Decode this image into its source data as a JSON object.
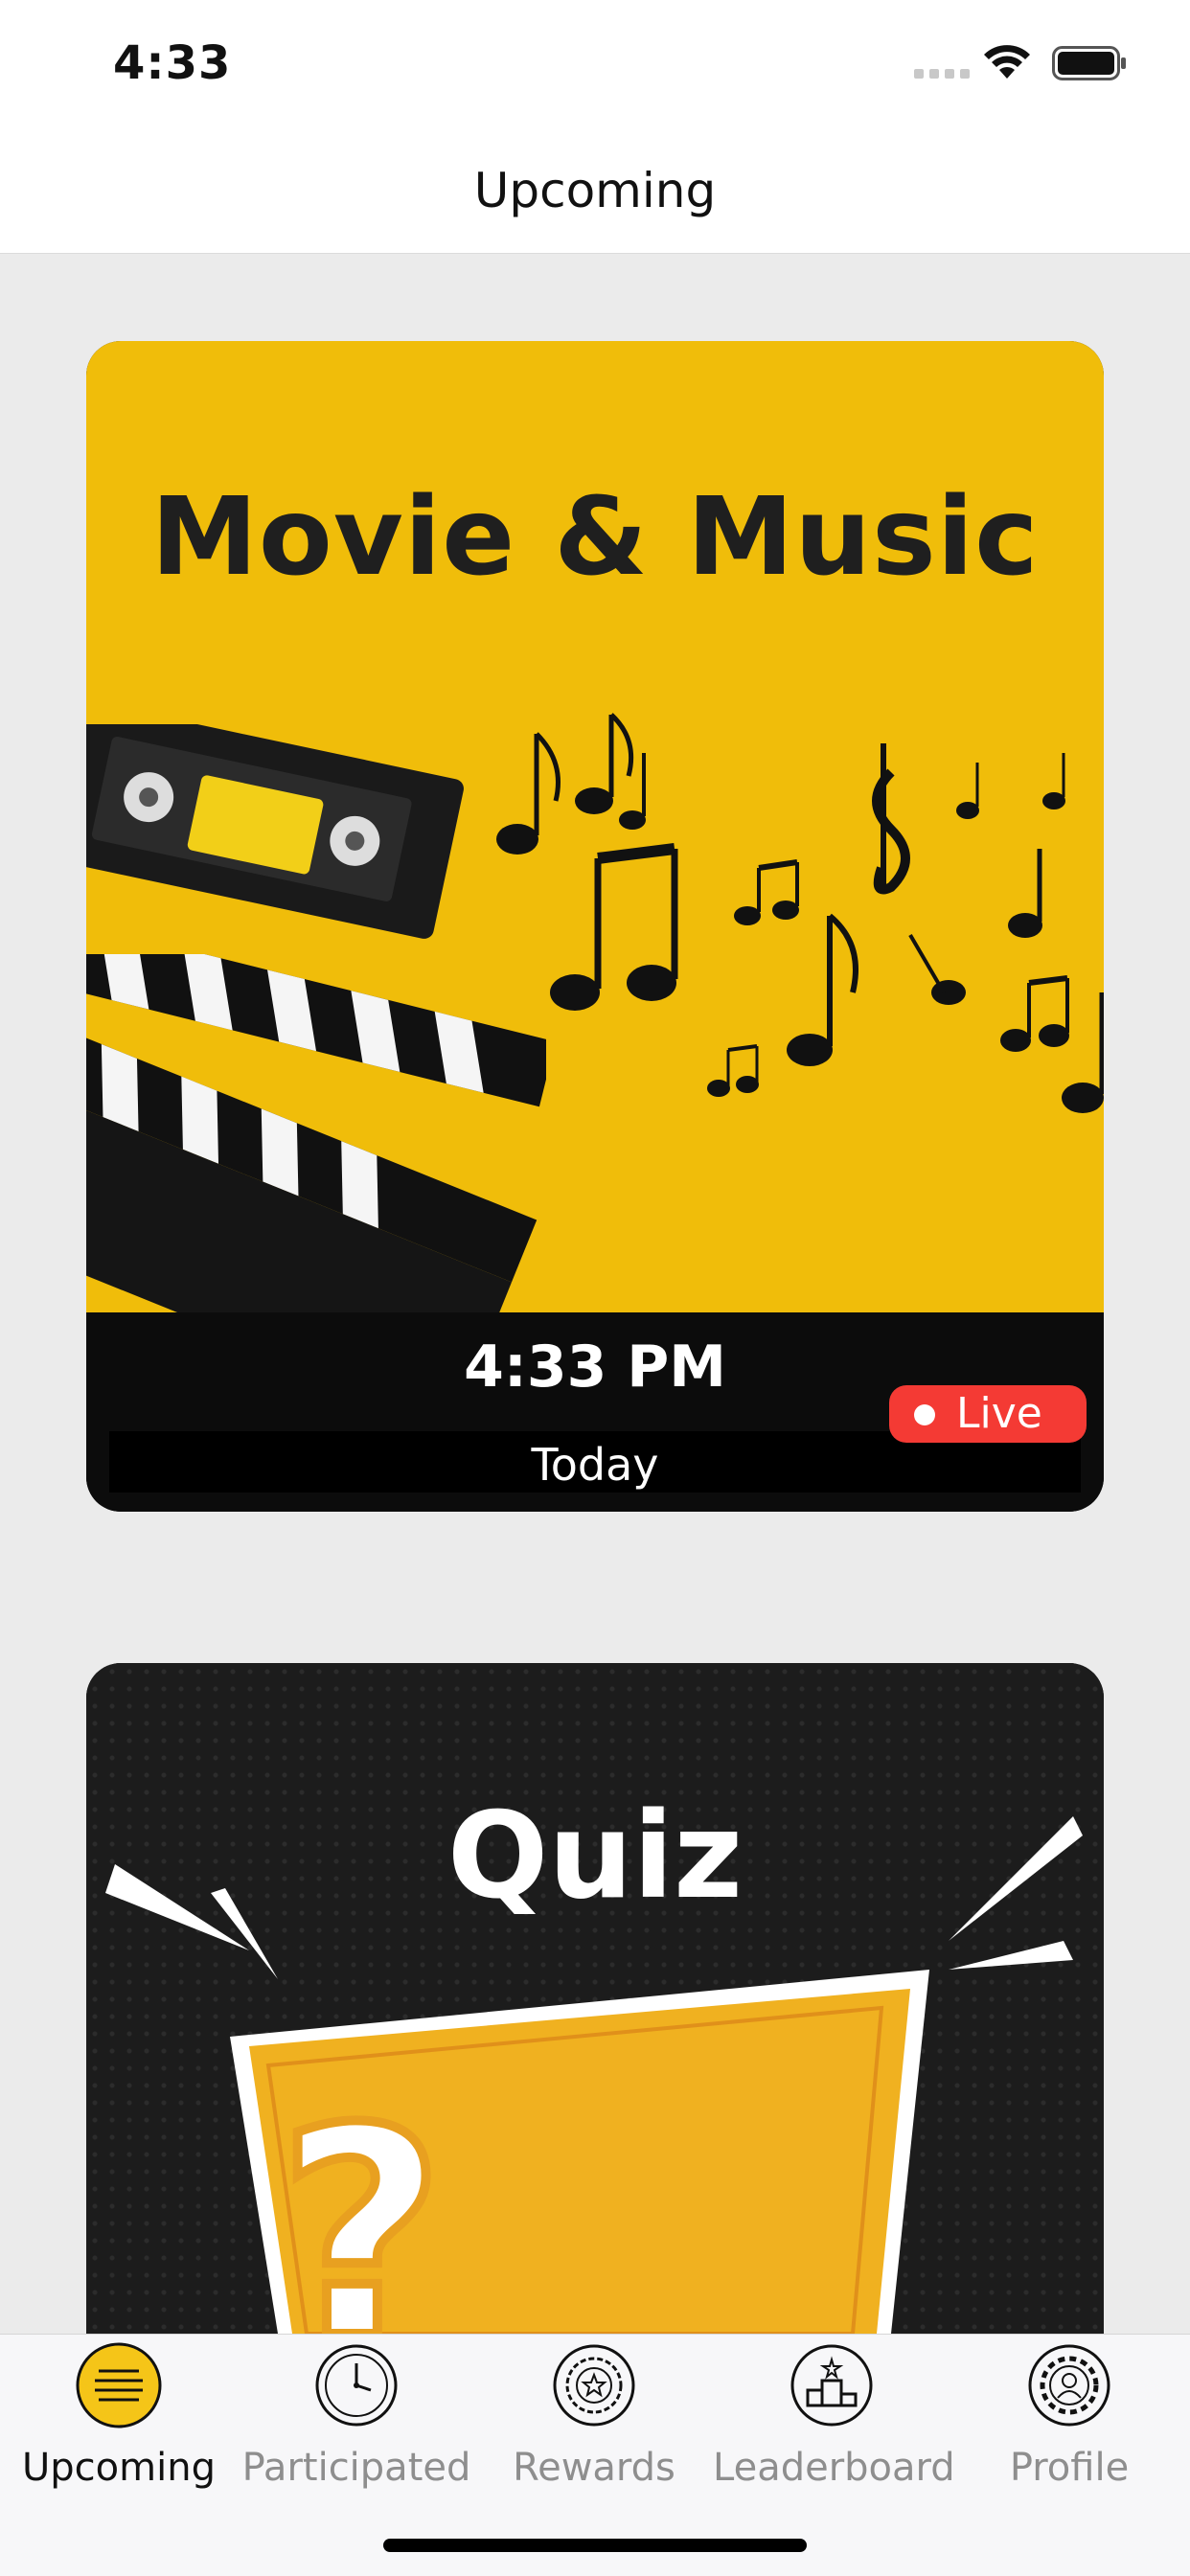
{
  "status_bar": {
    "time": "4:33"
  },
  "nav": {
    "title": "Upcoming"
  },
  "cards": [
    {
      "banner_title": "Movie & Music",
      "banner_color": "#f0bd0a",
      "time": "4:33 PM",
      "date": "Today",
      "badge": "Live",
      "badge_color": "#f43a34"
    },
    {
      "banner_title": "Quiz",
      "banner_color": "#1c1c1c"
    }
  ],
  "tabs": [
    {
      "label": "Upcoming",
      "icon": "list-icon",
      "active": true
    },
    {
      "label": "Participated",
      "icon": "clock-icon",
      "active": false
    },
    {
      "label": "Rewards",
      "icon": "reward-badge-icon",
      "active": false
    },
    {
      "label": "Leaderboard",
      "icon": "podium-icon",
      "active": false
    },
    {
      "label": "Profile",
      "icon": "profile-gear-icon",
      "active": false
    }
  ],
  "accent_color": "#f5c518"
}
